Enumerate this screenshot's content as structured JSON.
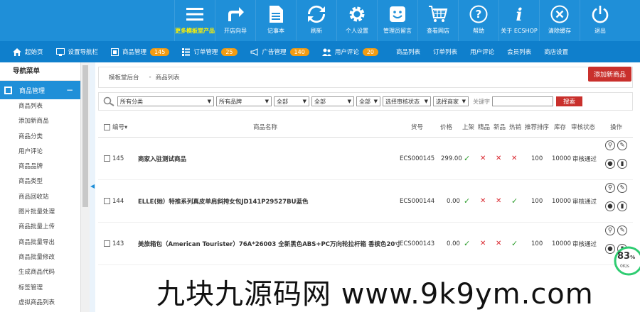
{
  "topbar": {
    "items": [
      {
        "label": "更多模板堂产品",
        "icon": "menu-icon"
      },
      {
        "label": "开店向导",
        "icon": "share-arrow-icon"
      },
      {
        "label": "记事本",
        "icon": "notepad-icon"
      },
      {
        "label": "刷新",
        "icon": "refresh-icon"
      },
      {
        "label": "个人设置",
        "icon": "gear-icon"
      },
      {
        "label": "管理员留言",
        "icon": "message-icon"
      },
      {
        "label": "查看网店",
        "icon": "cart-icon"
      },
      {
        "label": "帮助",
        "icon": "help-icon"
      },
      {
        "label": "关于 ECSHOP",
        "icon": "info-icon"
      },
      {
        "label": "清除缓存",
        "icon": "close-circle-icon"
      },
      {
        "label": "退出",
        "icon": "power-icon"
      }
    ]
  },
  "subnav": {
    "items": [
      {
        "label": "起始页",
        "icon": "home-icon",
        "badge": null
      },
      {
        "label": "设置导航栏",
        "icon": "monitor-icon",
        "badge": null
      },
      {
        "label": "商品管理",
        "icon": "product-icon",
        "badge": "145"
      },
      {
        "label": "订单管理",
        "icon": "order-icon",
        "badge": "25"
      },
      {
        "label": "广告管理",
        "icon": "megaphone-icon",
        "badge": "140"
      },
      {
        "label": "用户评论",
        "icon": "users-icon",
        "badge": "20"
      },
      {
        "label": "商品列表",
        "icon": null,
        "badge": null
      },
      {
        "label": "订单列表",
        "icon": null,
        "badge": null
      },
      {
        "label": "用户评论",
        "icon": null,
        "badge": null
      },
      {
        "label": "会员列表",
        "icon": null,
        "badge": null
      },
      {
        "label": "商店设置",
        "icon": null,
        "badge": null
      }
    ]
  },
  "sidebar": {
    "header": "导航菜单",
    "group": "商品管理",
    "items": [
      "商品列表",
      "添加新商品",
      "商品分类",
      "用户评论",
      "商品品牌",
      "商品类型",
      "商品回收站",
      "图片批量处理",
      "商品批量上传",
      "商品批量导出",
      "商品批量修改",
      "生成商品代码",
      "标签管理",
      "虚拟商品列表"
    ]
  },
  "breadcrumb": {
    "root": "模板堂后台",
    "sep": "-",
    "current": "商品列表"
  },
  "add_button": "添加新商品",
  "filter": {
    "selects": [
      "所有分类",
      "所有品牌",
      "全部",
      "全部",
      "全部",
      "选择审核状态",
      "选择商家"
    ],
    "keyword_label": "关键字",
    "search_button": "搜索"
  },
  "table": {
    "headers": {
      "id": "编号",
      "name": "商品名称",
      "sn": "货号",
      "price": "价格",
      "onsale": "上架",
      "best": "精品",
      "new": "新品",
      "hot": "热销",
      "sort": "推荐排序",
      "stock": "库存",
      "review": "审核状态",
      "ops": "操作"
    },
    "rows": [
      {
        "id": "145",
        "name": "商家入驻测试商品",
        "sn": "ECS000145",
        "price": "299.00",
        "onsale": true,
        "best": false,
        "new": false,
        "hot": false,
        "sort": "100",
        "stock": "10000",
        "review": "审核通过"
      },
      {
        "id": "144",
        "name": "ELLE(她）特推系列真皮单肩斜挎女包JD141P29527BU蓝色",
        "sn": "ECS000144",
        "price": "0.00",
        "onsale": true,
        "best": false,
        "new": false,
        "hot": true,
        "sort": "100",
        "stock": "10000",
        "review": "审核通过"
      },
      {
        "id": "143",
        "name": "美旅箱包（American Tourister）76A*26003 全新黑色ABS+PC万向轮拉杆箱 香槟色20寸",
        "sn": "ECS000143",
        "price": "0.00",
        "onsale": true,
        "best": false,
        "new": false,
        "hot": true,
        "sort": "100",
        "stock": "10000",
        "review": "审核通过"
      }
    ]
  },
  "speed": {
    "percent": "83",
    "unit": "%",
    "rate": "0K/s"
  },
  "watermark": "九块九源码网 www.9k9ym.com",
  "colors": {
    "primary": "#1f8fd8",
    "accent": "#c9302c",
    "badge": "#f39c12"
  }
}
